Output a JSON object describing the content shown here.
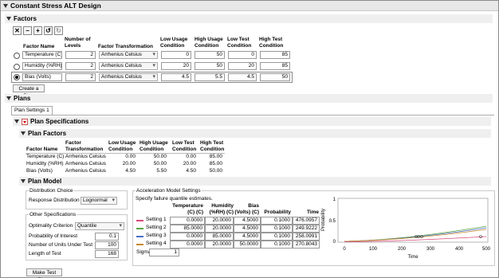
{
  "window_title": "Constant Stress ALT Design",
  "factors_section": {
    "title": "Factors",
    "toolbar": [
      "✕",
      "−",
      "+",
      "↺",
      "↻"
    ],
    "headers": {
      "factor_name": "Factor Name",
      "levels": "Number of Levels",
      "transformation": "Factor Transformation",
      "low_usage": "Low Usage Condition",
      "high_usage": "High Usage Condition",
      "low_test": "Low Test Condition",
      "high_test": "High Test Condition"
    },
    "rows": [
      {
        "name": "Temperature (C)",
        "levels": "2",
        "transformation": "Arrhenius Celsius",
        "low_usage": "0",
        "high_usage": "50",
        "low_test": "0",
        "high_test": "85",
        "selected": false
      },
      {
        "name": "Humidity (%RH)",
        "levels": "2",
        "transformation": "Arrhenius Celsius",
        "low_usage": "20",
        "high_usage": "50",
        "low_test": "20",
        "high_test": "85",
        "selected": false
      },
      {
        "name": "Bias (Volts)",
        "levels": "2",
        "transformation": "Arrhenius Celsius",
        "low_usage": "4.5",
        "high_usage": "5.5",
        "low_test": "4.5",
        "high_test": "50",
        "selected": true
      }
    ],
    "create_plan_label": "Create a Plan"
  },
  "plans_section": {
    "title": "Plans",
    "tab_label": "Plan Settings 1",
    "plan_specifications_title": "Plan Specifications",
    "plan_factors": {
      "title": "Plan Factors",
      "headers": {
        "factor_name": "Factor Name",
        "transformation": "Factor Transformation",
        "low_usage": "Low Usage Condition",
        "high_usage": "High Usage Condition",
        "low_test": "Low Test Condition",
        "high_test": "High Test Condition"
      },
      "rows": [
        {
          "name": "Temperature (C)",
          "transformation": "Arrhenius Celsius",
          "low_usage": "0.00",
          "high_usage": "50.00",
          "low_test": "0.00",
          "high_test": "85.00"
        },
        {
          "name": "Humidity (%RH)",
          "transformation": "Arrhenius Celsius",
          "low_usage": "20.00",
          "high_usage": "50.00",
          "low_test": "20.00",
          "high_test": "85.00"
        },
        {
          "name": "Bias (Volts)",
          "transformation": "Arrhenius Celsius",
          "low_usage": "4.50",
          "high_usage": "5.50",
          "low_test": "4.50",
          "high_test": "50.00"
        }
      ]
    },
    "plan_model": {
      "title": "Plan Model",
      "distribution_choice": {
        "title": "Distribution Choice",
        "response_label": "Response Distribution",
        "response_value": "Lognormal"
      },
      "other_specs": {
        "title": "Other Specifications",
        "optimality_label": "Optimality Criterion",
        "optimality_value": "Quantile",
        "prob_label": "Probability of Interest",
        "prob_value": "0.1",
        "units_label": "Number of Units Under Test",
        "units_value": "100",
        "length_label": "Length of Test",
        "length_value": "168"
      },
      "acceleration": {
        "title": "Acceleration Model Settings",
        "subtitle": "Specify failure quantile estimates.",
        "headers": {
          "temp": "Temperature (C) (C)",
          "humidity": "Humidity (%RH) (C)",
          "bias": "Bias (Volts) (C)",
          "probability": "Probability",
          "time": "Time"
        },
        "rows": [
          {
            "label": "Setting 1",
            "color": "#d94b7a",
            "temp": "0.0000",
            "humidity": "20.0000",
            "bias": "4.5000",
            "probability": "0.1000",
            "time": "476.0957"
          },
          {
            "label": "Setting 2",
            "color": "#5aa642",
            "temp": "85.0000",
            "humidity": "20.0000",
            "bias": "4.5000",
            "probability": "0.1000",
            "time": "249.9222"
          },
          {
            "label": "Setting 3",
            "color": "#4a6fc9",
            "temp": "0.0000",
            "humidity": "85.0000",
            "bias": "4.5000",
            "probability": "0.1000",
            "time": "258.0991"
          },
          {
            "label": "Setting 4",
            "color": "#c98a2c",
            "temp": "0.0000",
            "humidity": "20.0000",
            "bias": "50.0000",
            "probability": "0.1000",
            "time": "270.8043"
          }
        ],
        "sigma_label": "Sigma",
        "sigma_value": "1"
      },
      "mini_plot": {
        "ylabel": "Probability",
        "xlabel": "Time",
        "yticks": [
          "1",
          "0.5",
          "0"
        ],
        "xticks": [
          "0",
          "100",
          "200",
          "300",
          "400",
          "500"
        ]
      }
    },
    "make_test_plans_label": "Make Test Plans"
  }
}
